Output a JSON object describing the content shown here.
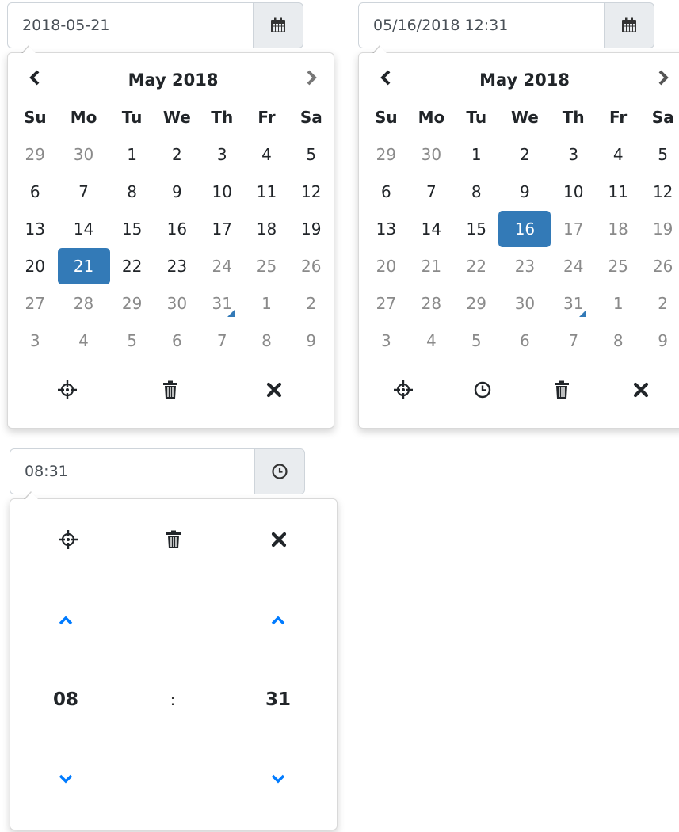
{
  "colors": {
    "accent": "#337ab7",
    "link": "#007bff",
    "muted": "#8a8a8a"
  },
  "picker1": {
    "input_value": "2018-05-21",
    "addon_icon": "calendar-icon",
    "title": "May 2018",
    "weekdays": [
      "Su",
      "Mo",
      "Tu",
      "We",
      "Th",
      "Fr",
      "Sa"
    ],
    "weeks": [
      [
        "29",
        "30",
        "1",
        "2",
        "3",
        "4",
        "5"
      ],
      [
        "6",
        "7",
        "8",
        "9",
        "10",
        "11",
        "12"
      ],
      [
        "13",
        "14",
        "15",
        "16",
        "17",
        "18",
        "19"
      ],
      [
        "20",
        "21",
        "22",
        "23",
        "24",
        "25",
        "26"
      ],
      [
        "27",
        "28",
        "29",
        "30",
        "31",
        "1",
        "2"
      ],
      [
        "3",
        "4",
        "5",
        "6",
        "7",
        "8",
        "9"
      ]
    ],
    "selected_day": "21",
    "today_day": "31",
    "toolbar_icons": [
      "today-crosshair-icon",
      "trash-icon",
      "close-icon"
    ]
  },
  "picker2": {
    "input_value": "05/16/2018 12:31",
    "addon_icon": "calendar-icon",
    "title": "May 2018",
    "weekdays": [
      "Su",
      "Mo",
      "Tu",
      "We",
      "Th",
      "Fr",
      "Sa"
    ],
    "weeks": [
      [
        "29",
        "30",
        "1",
        "2",
        "3",
        "4",
        "5"
      ],
      [
        "6",
        "7",
        "8",
        "9",
        "10",
        "11",
        "12"
      ],
      [
        "13",
        "14",
        "15",
        "16",
        "17",
        "18",
        "19"
      ],
      [
        "20",
        "21",
        "22",
        "23",
        "24",
        "25",
        "26"
      ],
      [
        "27",
        "28",
        "29",
        "30",
        "31",
        "1",
        "2"
      ],
      [
        "3",
        "4",
        "5",
        "6",
        "7",
        "8",
        "9"
      ]
    ],
    "selected_day": "16",
    "today_day": "31",
    "toolbar_icons": [
      "today-crosshair-icon",
      "clock-icon",
      "trash-icon",
      "close-icon"
    ]
  },
  "picker3": {
    "input_value": "08:31",
    "addon_icon": "clock-icon",
    "toolbar_icons": [
      "today-crosshair-icon",
      "trash-icon",
      "close-icon"
    ],
    "hour": "08",
    "separator": ":",
    "minute": "31"
  }
}
